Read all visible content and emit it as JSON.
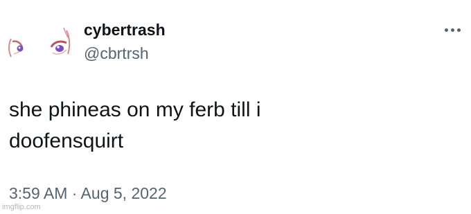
{
  "tweet": {
    "display_name": "cybertrash",
    "handle": "@cbrtrsh",
    "text": "she phineas on my ferb till i\ndoofensquirt",
    "timestamp": "3:59 AM · Aug 5, 2022",
    "more_icon": "more-horizontal-icon",
    "avatar_description": "anime-eyes-avatar"
  },
  "watermark": {
    "text": "imgflip.com"
  },
  "colors": {
    "text_primary": "#0f1419",
    "text_secondary": "#536471",
    "background": "#ffffff",
    "eye_iris": "#7a4fc2"
  }
}
